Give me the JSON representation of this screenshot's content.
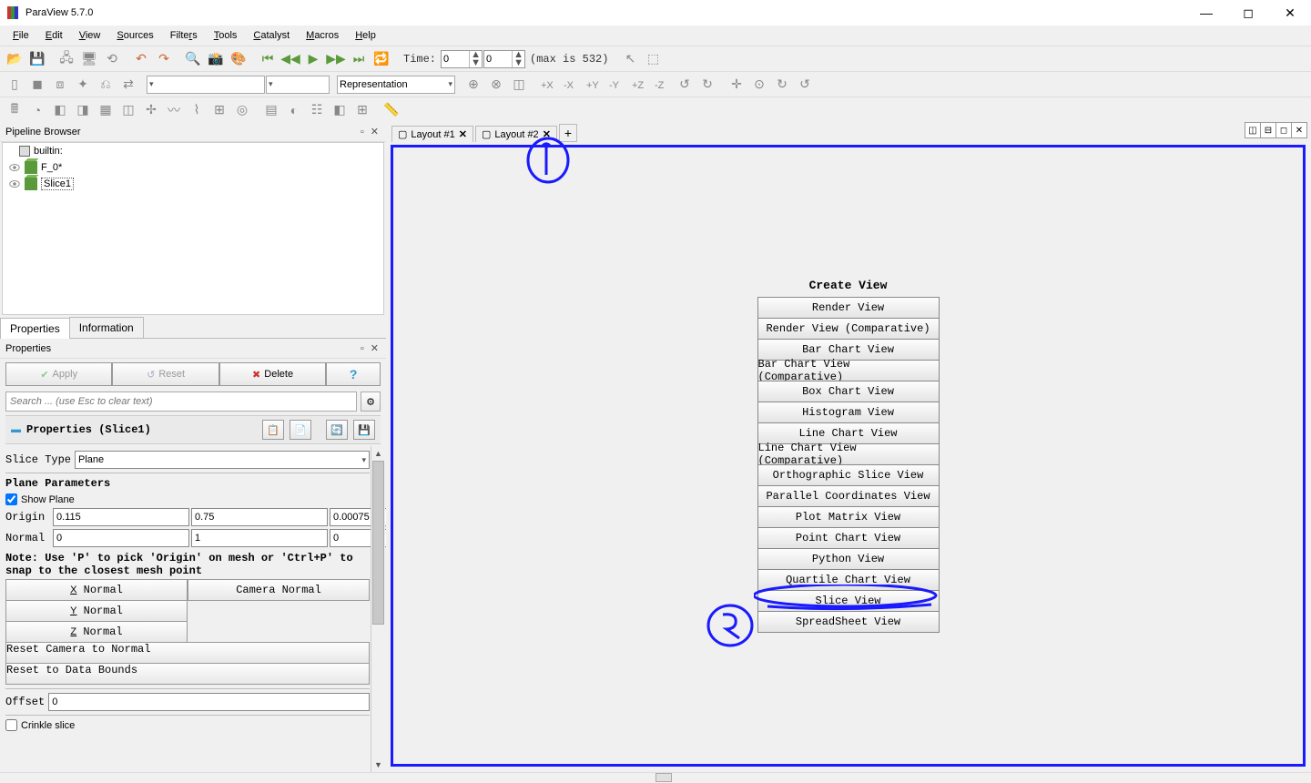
{
  "app": {
    "title": "ParaView 5.7.0"
  },
  "menu": {
    "file": "File",
    "edit": "Edit",
    "view": "View",
    "sources": "Sources",
    "filters": "Filters",
    "tools": "Tools",
    "catalyst": "Catalyst",
    "macros": "Macros",
    "help": "Help"
  },
  "time": {
    "label": "Time:",
    "current": "0",
    "index": "0",
    "max_text": "(max is 532)"
  },
  "repr": {
    "label": "Representation"
  },
  "pipeline": {
    "title": "Pipeline Browser",
    "items": {
      "builtin": "builtin:",
      "f0": "F_0*",
      "slice": "Slice1"
    }
  },
  "proptabs": {
    "properties": "Properties",
    "information": "Information"
  },
  "properties": {
    "title": "Properties",
    "apply": "Apply",
    "reset": "Reset",
    "delete": "Delete",
    "help": "?",
    "search_ph": "Search ... (use Esc to clear text)",
    "section": "Properties (Slice1)",
    "slice_type_label": "Slice Type",
    "slice_type": "Plane",
    "plane_params": "Plane Parameters",
    "show_plane": "Show Plane",
    "origin_label": "Origin",
    "origin": [
      "0.115",
      "0.75",
      "0.00075"
    ],
    "normal_label": "Normal",
    "normal": [
      "0",
      "1",
      "0"
    ],
    "note": "Note: Use 'P' to pick 'Origin' on mesh or 'Ctrl+P' to snap to the closest mesh point",
    "x_normal": "X Normal",
    "y_normal": "Y Normal",
    "z_normal": "Z Normal",
    "camera_normal": "Camera Normal",
    "reset_cam": "Reset Camera to Normal",
    "reset_bounds": "Reset to Data Bounds",
    "offset_label": "Offset",
    "offset": "0",
    "crinkle": "Crinkle slice"
  },
  "layouts": {
    "l1": "Layout #1",
    "l2": "Layout #2"
  },
  "createview": {
    "title": "Create View",
    "options": [
      "Render View",
      "Render View (Comparative)",
      "Bar Chart View",
      "Bar Chart View (Comparative)",
      "Box Chart View",
      "Histogram View",
      "Line Chart View",
      "Line Chart View (Comparative)",
      "Orthographic Slice View",
      "Parallel Coordinates View",
      "Plot Matrix View",
      "Point Chart View",
      "Python View",
      "Quartile Chart View",
      "Slice View",
      "SpreadSheet View"
    ]
  }
}
